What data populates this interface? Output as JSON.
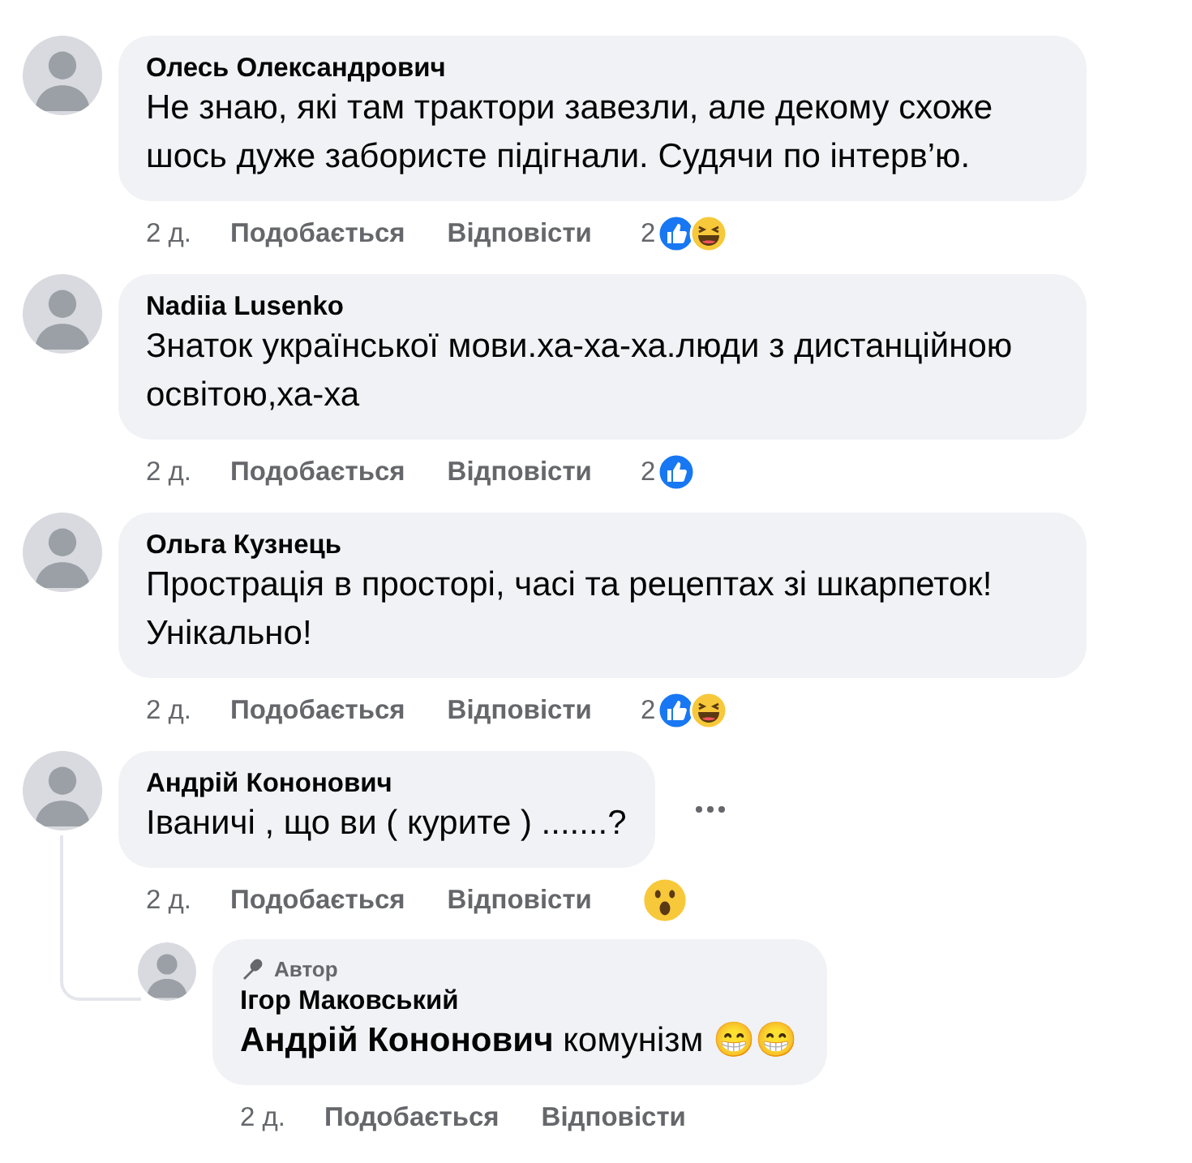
{
  "comments": [
    {
      "author": "Олесь Олександрович",
      "text": "Не знаю, які там трактори завезли, але декому схоже шось дуже забористе підігнали. Судячи по інтерв’ю.",
      "time": "2 д.",
      "like_label": "Подобається",
      "reply_label": "Відповісти",
      "reaction_count": "2",
      "reactions": [
        {
          "kind": "like"
        },
        {
          "kind": "haha"
        }
      ],
      "has_menu": false
    },
    {
      "author": "Nadiia Lusenko",
      "text": "Знаток української мови.ха-ха-ха.люди з дистанційною освітою,ха-ха",
      "time": "2 д.",
      "like_label": "Подобається",
      "reply_label": "Відповісти",
      "reaction_count": "2",
      "reactions": [
        {
          "kind": "like"
        }
      ],
      "has_menu": false
    },
    {
      "author": "Ольга Кузнець",
      "text": "Прострація в просторі, часі та рецептах зі шкарпеток! Унікально!",
      "time": "2 д.",
      "like_label": "Подобається",
      "reply_label": "Відповісти",
      "reaction_count": "2",
      "reactions": [
        {
          "kind": "like"
        },
        {
          "kind": "haha"
        }
      ],
      "has_menu": false
    },
    {
      "author": "Андрій Кононович",
      "text": "Іваничі , що ви ( курите ) .......?",
      "time": "2 д.",
      "like_label": "Подобається",
      "reply_label": "Відповісти",
      "reactions": [
        {
          "kind": "wow"
        }
      ],
      "has_menu": true,
      "replies": [
        {
          "badge": "Автор",
          "author": "Ігор Маковський",
          "text": "**Андрій Кононович** комунізм 😁😁",
          "time": "2 д.",
          "like_label": "Подобається",
          "reply_label": "Відповісти"
        }
      ]
    }
  ]
}
